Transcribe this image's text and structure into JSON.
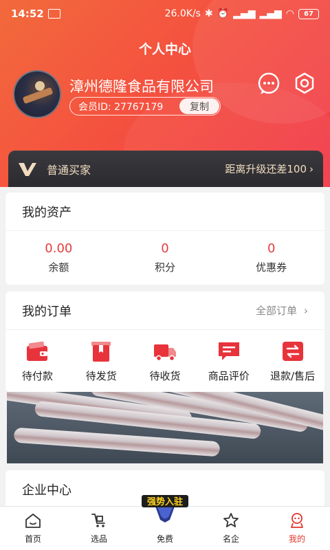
{
  "status_bar": {
    "time": "14:52",
    "network_speed": "26.0K/s",
    "battery": "67",
    "icons": [
      "bluetooth-icon",
      "alarm-icon",
      "signal-icon",
      "signal-icon",
      "wifi-icon"
    ]
  },
  "page_title": "个人中心",
  "profile": {
    "company": "漳州德隆食品有限公司",
    "member_id": "会员ID: 27767179",
    "copy_label": "复制"
  },
  "vip": {
    "level": "普通买家",
    "upgrade": "距离升级还差100"
  },
  "assets": {
    "title": "我的资产",
    "items": [
      {
        "value": "0.00",
        "label": "余额"
      },
      {
        "value": "0",
        "label": "积分"
      },
      {
        "value": "0",
        "label": "优惠券"
      }
    ]
  },
  "orders": {
    "title": "我的订单",
    "all_label": "全部订单",
    "items": [
      {
        "label": "待付款",
        "icon": "wallet-icon"
      },
      {
        "label": "待发货",
        "icon": "package-icon"
      },
      {
        "label": "待收货",
        "icon": "truck-icon"
      },
      {
        "label": "商品评价",
        "icon": "comment-icon"
      },
      {
        "label": "退款/售后",
        "icon": "exchange-icon"
      }
    ]
  },
  "enterprise": {
    "title": "企业中心"
  },
  "tabbar": {
    "items": [
      {
        "label": "首页",
        "icon": "home-icon"
      },
      {
        "label": "选品",
        "icon": "cart-icon"
      },
      {
        "label": "免费",
        "icon": "free-badge-icon"
      },
      {
        "label": "名企",
        "icon": "star-icon"
      },
      {
        "label": "我的",
        "icon": "user-icon"
      }
    ],
    "badge_text": "强势入驻",
    "active_color": "#e0352b"
  },
  "colors": {
    "header_gradient_start": "#f26a3c",
    "header_gradient_end": "#f23a4a",
    "accent": "#e63c3c"
  }
}
